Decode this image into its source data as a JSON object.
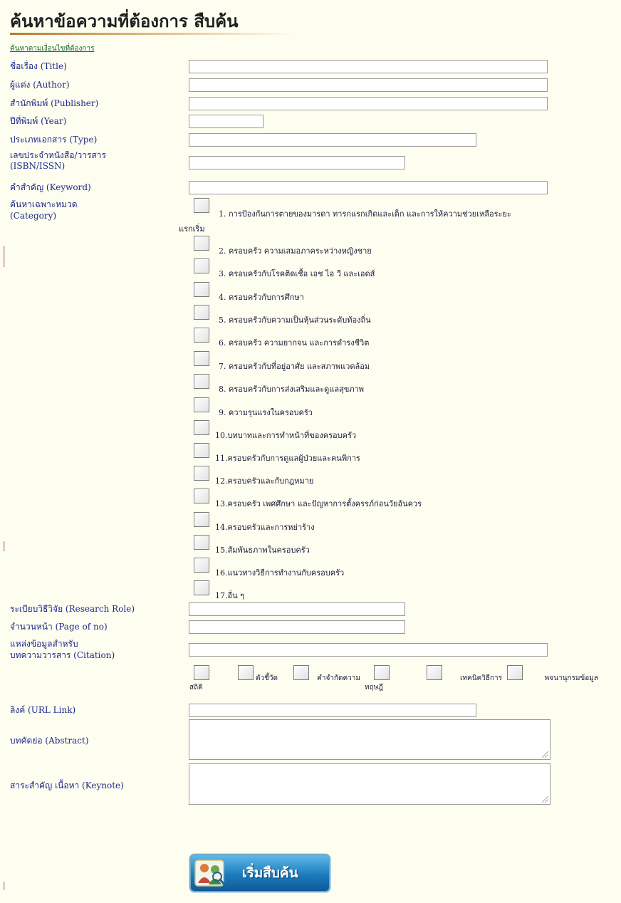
{
  "page_title": "ค้นหาข้อความที่ต้องการ สืบค้น",
  "search_link": "ค้นหาตามเงื่อนไขที่ต้องการ",
  "fields": {
    "title": {
      "label": "ชื่อเรื่อง (Title)",
      "value": ""
    },
    "author": {
      "label": "ผู้แต่ง (Author)",
      "value": ""
    },
    "publisher": {
      "label": "สำนักพิมพ์ (Publisher)",
      "value": ""
    },
    "year": {
      "label": "ปีที่พิมพ์ (Year)",
      "value": ""
    },
    "type": {
      "label": "ประเภทเอกสาร (Type)",
      "value": ""
    },
    "isbn": {
      "label_line1": "เลขประจำหนังสือ/วารสาร",
      "label_line2": "(ISBN/ISSN)",
      "value": ""
    },
    "keyword": {
      "label": "คำสำคัญ (Keyword)",
      "value": ""
    },
    "category": {
      "label_line1": "ค้นหาเฉพาะหมวด",
      "label_line2": "(Category)"
    },
    "research_role": {
      "label": "ระเบียบวิธีวิจัย (Research Role)",
      "value": ""
    },
    "page_of_no": {
      "label": "จำนวนหน้า (Page of no)",
      "value": ""
    },
    "citation": {
      "label_line1": "แหล่งข้อมูลสำหรับ",
      "label_line2": "บทความวารสาร (Citation)",
      "value": ""
    },
    "url_link": {
      "label": "ลิงค์ (URL Link)",
      "value": ""
    },
    "abstract": {
      "label": "บทคัดย่อ (Abstract)",
      "value": ""
    },
    "keynote": {
      "label": "สาระสำคัญ เนื้อหา (Keynote)",
      "value": ""
    }
  },
  "categories": [
    {
      "line1": "1. การป้องกันการตายของมารดา ทารกแรกเกิดและเด็ก และการให้ความช่วยเหลือระยะ",
      "line2": "แรกเริ่ม",
      "checked": false
    },
    {
      "text": "2. ครอบครัว ความเสมอภาคระหว่างหญิงชาย",
      "checked": false
    },
    {
      "text": "3. ครอบครัวกับโรคติดเชื้อ เอช ไอ วี และเอดส์",
      "checked": false
    },
    {
      "text": "4. ครอบครัวกับการศึกษา",
      "checked": false
    },
    {
      "text": "5. ครอบครัวกับความเป็นหุ้นส่วนระดับท้องถิ่น",
      "checked": false
    },
    {
      "text": "6. ครอบครัว ความยากจน และการดำรงชีวิต",
      "checked": false
    },
    {
      "text": "7. ครอบครัวกับที่อยู่อาศัย และสภาพแวดล้อม",
      "checked": false
    },
    {
      "text": "8. ครอบครัวกับการส่งเสริมและดูแลสุขภาพ",
      "checked": false
    },
    {
      "text": "9. ความรุนแรงในครอบครัว",
      "checked": false
    },
    {
      "text": "10.บทบาทและการทำหน้าที่ของครอบครัว",
      "checked": false
    },
    {
      "text": "11.ครอบครัวกับการดูแลผู้ป่วยและคนพิการ",
      "checked": false
    },
    {
      "text": "12.ครอบครัวและกับกฎหมาย",
      "checked": false
    },
    {
      "text": "13.ครอบครัว เพศศึกษา และปัญหาการตั้งครรภ์ก่อนวัยอันควร",
      "checked": false
    },
    {
      "text": "14.ครอบครัวและการหย่าร้าง",
      "checked": false
    },
    {
      "text": "15.สัมพันธภาพในครอบครัว",
      "checked": false
    },
    {
      "text": "16.แนวทางวิธีการทำงานกับครอบครัว",
      "checked": false
    },
    {
      "text": "17.อื่น ๆ",
      "checked": false
    }
  ],
  "citation_options": [
    {
      "label": "สถิติ",
      "checked": false
    },
    {
      "label": "ตัวชี้วัด",
      "checked": false
    },
    {
      "label": "คำจำกัดความ",
      "checked": false
    },
    {
      "label": "ทฤษฎี",
      "checked": false
    },
    {
      "label": "เทคนิควิธีการ",
      "checked": false
    },
    {
      "label": "พจนานุกรมข้อมูล",
      "checked": false
    }
  ],
  "submit": {
    "label": "เริ่มสืบค้น",
    "icon": "search-figures-icon"
  },
  "colors": {
    "label": "#1f2a8c",
    "link": "#1a6b2a",
    "background": "#fdfdf0",
    "button": "#1c7cbd"
  }
}
